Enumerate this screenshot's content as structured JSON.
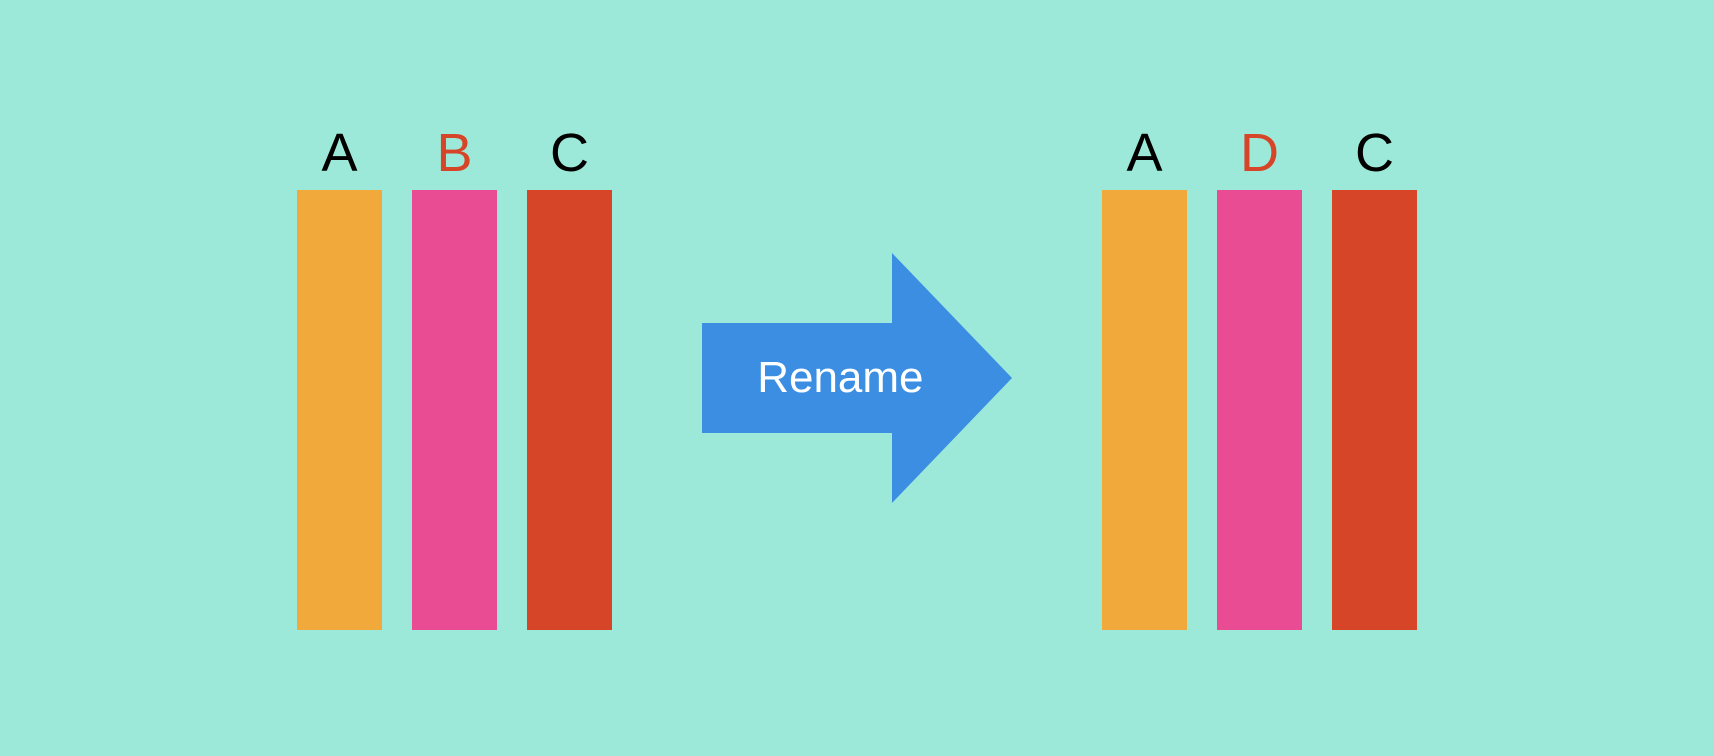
{
  "operation": "Rename",
  "groups": {
    "before": [
      {
        "label": "A",
        "highlight": false,
        "color": "#f2a93c"
      },
      {
        "label": "B",
        "highlight": true,
        "color": "#e94c93"
      },
      {
        "label": "C",
        "highlight": false,
        "color": "#d64527"
      }
    ],
    "after": [
      {
        "label": "A",
        "highlight": false,
        "color": "#f2a93c"
      },
      {
        "label": "D",
        "highlight": true,
        "color": "#e94c93"
      },
      {
        "label": "C",
        "highlight": false,
        "color": "#d64527"
      }
    ]
  },
  "colors": {
    "background": "#9de9d9",
    "arrow": "#3b8ee2",
    "highlightText": "#d64527",
    "normalText": "#000000"
  }
}
